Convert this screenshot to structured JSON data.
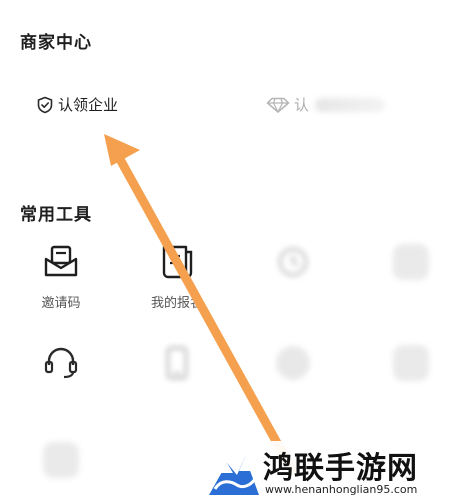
{
  "merchant_center": {
    "title": "商家中心",
    "claim_label": "认领企业",
    "verify_label": "认"
  },
  "tools": {
    "title": "常用工具",
    "items": [
      {
        "label": "邀请码",
        "icon": "invite-mail-icon"
      },
      {
        "label": "我的报名",
        "icon": "document-icon"
      },
      {
        "label": "",
        "icon": "history-icon"
      },
      {
        "label": "",
        "icon": "app-icon"
      },
      {
        "label": "",
        "icon": "headset-icon"
      },
      {
        "label": "",
        "icon": "phone-icon"
      },
      {
        "label": "",
        "icon": "app-icon"
      },
      {
        "label": "",
        "icon": "app-icon"
      },
      {
        "label": "",
        "icon": "app-icon"
      }
    ]
  },
  "watermark": {
    "title": "鸿联手游网",
    "url": "www.henanhonglian95.com"
  },
  "colors": {
    "arrow": "#F5A04E",
    "text": "#1F1F1F",
    "muted": "#555555",
    "logo_blue": "#2B6FD6"
  }
}
